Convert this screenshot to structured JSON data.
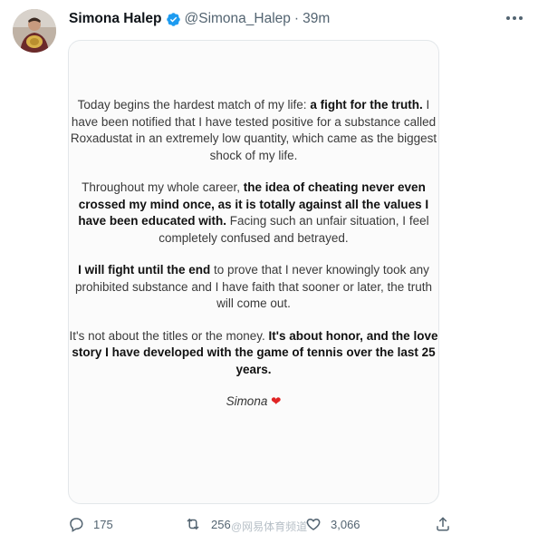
{
  "tweet": {
    "display_name": "Simona Halep",
    "handle": "@Simona_Halep",
    "separator": "·",
    "time": "39m",
    "verified_icon": "verified-badge-icon",
    "more_icon": "more-horizontal-icon"
  },
  "statement": {
    "p1": {
      "pre": "Today begins the hardest match of my life: ",
      "bold": "a fight for the truth.",
      "post": " I have been notified that I have tested positive for a substance called Roxadustat in an extremely low quantity, which came as the biggest shock of my life."
    },
    "p2": {
      "pre": "Throughout my whole career, ",
      "bold": "the idea of cheating never even crossed my mind once, as it is totally against all the values I have been educated with.",
      "post": " Facing such an unfair situation, I feel completely confused and betrayed."
    },
    "p3": {
      "bold": "I will fight until the end",
      "post": " to prove that I never knowingly took any prohibited substance and I have faith that sooner or later, the truth will come out."
    },
    "p4": {
      "pre": "It's not about the titles or the money. ",
      "bold": "It's about honor, and the love story I have developed with the game of tennis over the last 25 years."
    },
    "signature": "Simona",
    "heart": "❤"
  },
  "actions": {
    "reply_count": "175",
    "retweet_count": "256",
    "like_count": "3,066",
    "reply_icon": "reply-icon",
    "retweet_icon": "retweet-icon",
    "like_icon": "heart-icon",
    "share_icon": "share-icon"
  },
  "watermark": "@网易体育频道",
  "colors": {
    "verified": "#1d9bf0",
    "muted": "#536471",
    "heart": "#e02424"
  }
}
